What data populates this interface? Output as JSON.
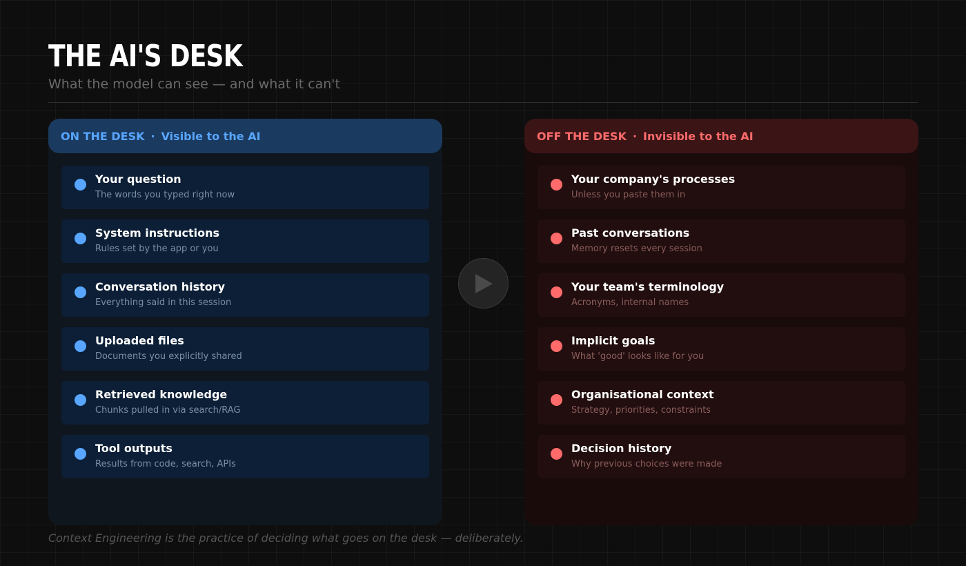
{
  "header": {
    "title": "THE AI'S DESK",
    "subtitle": "What the model can see — and what it can't"
  },
  "on_desk": {
    "label": "ON THE DESK",
    "separator": "·",
    "tag": "Visible to the AI",
    "color": "#58a6ff",
    "items": [
      {
        "title": "Your question",
        "desc": "The words you typed right now"
      },
      {
        "title": "System instructions",
        "desc": "Rules set by the app or you"
      },
      {
        "title": "Conversation history",
        "desc": "Everything said in this session"
      },
      {
        "title": "Uploaded files",
        "desc": "Documents you explicitly shared"
      },
      {
        "title": "Retrieved knowledge",
        "desc": "Chunks pulled in via search/RAG"
      },
      {
        "title": "Tool outputs",
        "desc": "Results from code, search, APIs"
      }
    ]
  },
  "off_desk": {
    "label": "OFF THE DESK",
    "separator": "·",
    "tag": "Invisible to the AI",
    "color": "#ff6b6b",
    "items": [
      {
        "title": "Your company's processes",
        "desc": "Unless you paste them in"
      },
      {
        "title": "Past conversations",
        "desc": "Memory resets every session"
      },
      {
        "title": "Your team's terminology",
        "desc": "Acronyms, internal names"
      },
      {
        "title": "Implicit goals",
        "desc": "What 'good' looks like for you"
      },
      {
        "title": "Organisational context",
        "desc": "Strategy, priorities, constraints"
      },
      {
        "title": "Decision history",
        "desc": "Why previous choices were made"
      }
    ]
  },
  "center": {
    "icon": "play-icon"
  },
  "footer": {
    "text": "Context Engineering is the practice of deciding what goes on the desk — deliberately."
  }
}
